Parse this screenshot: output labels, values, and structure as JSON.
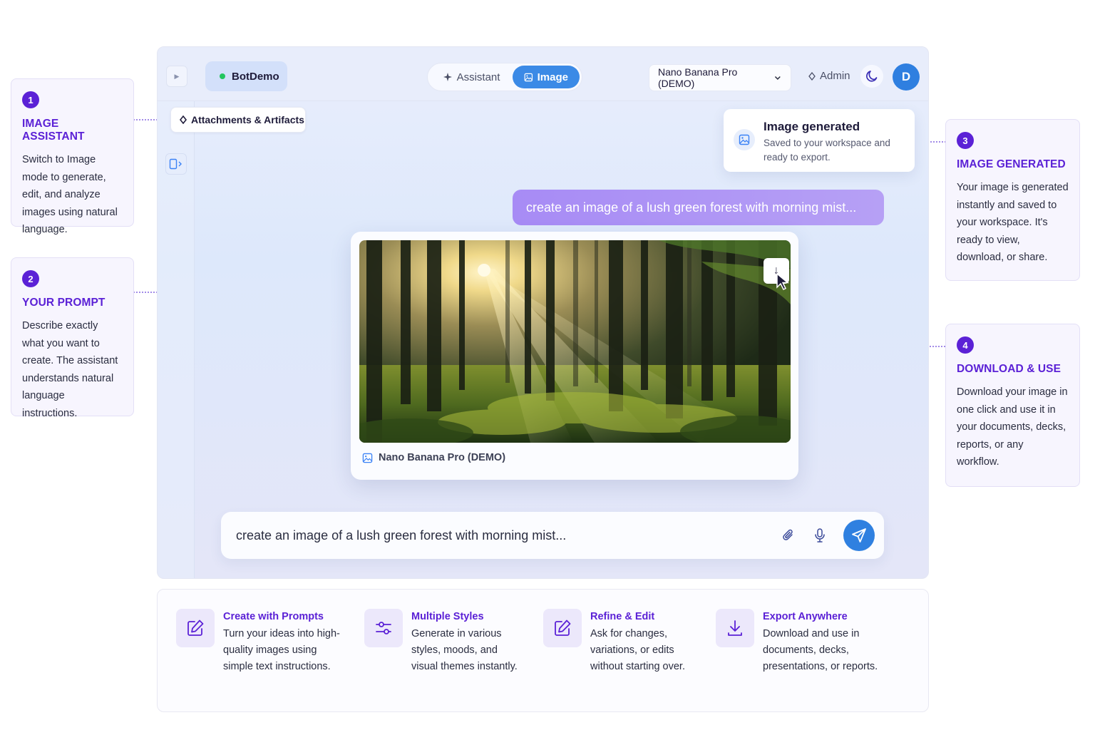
{
  "app": {
    "brand": "BotDemo",
    "modes": [
      {
        "label": "Assistant",
        "active": false
      },
      {
        "label": "Image",
        "active": true
      }
    ],
    "model_select": "Nano Banana Pro (DEMO)",
    "admin_label": "Admin",
    "avatar_initial": "D",
    "attachments_label": "Attachments & Artifacts",
    "toast": {
      "title": "Image generated",
      "body": "Saved to your workspace and ready to export."
    },
    "prompt_bubble": "create an image of a lush green forest with morning mist...",
    "image_caption": "Nano Banana Pro (DEMO)",
    "download_glyph": "↓",
    "composer_text": "create an image of a lush green forest with morning mist..."
  },
  "callouts": [
    {
      "num": "1",
      "title": "IMAGE ASSISTANT",
      "body": "Switch to Image mode to generate, edit, and analyze images using natural language."
    },
    {
      "num": "2",
      "title": "YOUR PROMPT",
      "body": "Describe exactly what you want to create. The assistant understands natural language instructions."
    },
    {
      "num": "3",
      "title": "IMAGE GENERATED",
      "body": "Your image is generated instantly and saved to your workspace. It's ready to view, download, or share."
    },
    {
      "num": "4",
      "title": "DOWNLOAD & USE",
      "body": "Download your image in one click and use it in your documents, decks, reports, or any workflow."
    }
  ],
  "features": [
    {
      "icon": "edit-icon",
      "title": "Create with Prompts",
      "body": "Turn your ideas into high-quality images using simple text instructions."
    },
    {
      "icon": "sliders-icon",
      "title": "Multiple Styles",
      "body": "Generate in various styles, moods, and visual themes instantly."
    },
    {
      "icon": "edit-icon",
      "title": "Refine & Edit",
      "body": "Ask for changes, variations, or edits without starting over."
    },
    {
      "icon": "download-icon",
      "title": "Export Anywhere",
      "body": "Download and use in documents, decks, presentations, or reports."
    }
  ],
  "colors": {
    "accent_purple": "#5b21d6",
    "accent_blue": "#2f80e0",
    "status_green": "#22c55e",
    "prompt_bubble": "#a78bf5"
  }
}
